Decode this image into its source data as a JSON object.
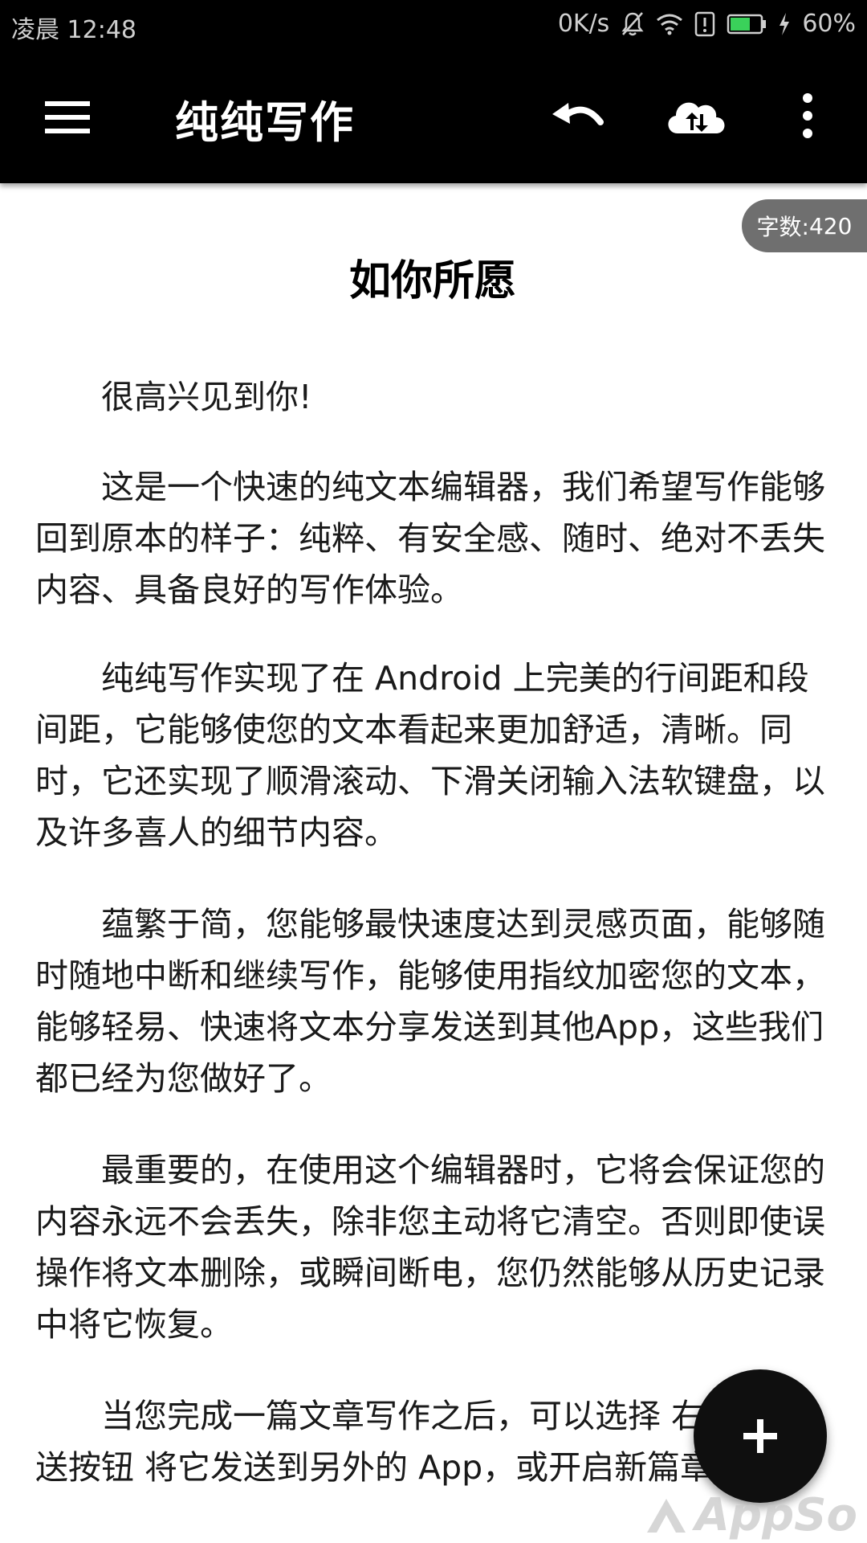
{
  "status_bar": {
    "time": "凌晨 12:48",
    "network_speed": "0K/s",
    "battery": "60%",
    "icons": [
      "bell-off-icon",
      "wifi-icon",
      "alert-icon",
      "battery-icon",
      "charging-icon"
    ]
  },
  "app_bar": {
    "title": "纯纯写作",
    "icons": [
      "menu-icon",
      "undo-icon",
      "cloud-sync-icon",
      "more-vertical-icon"
    ]
  },
  "word_count": {
    "label": "字数: ",
    "value": "420"
  },
  "document": {
    "title": "如你所愿",
    "paragraphs": [
      "很高兴见到你!",
      "这是一个快速的纯文本编辑器，我们希望写作能够回到原本的样子：纯粹、有安全感、随时、绝对不丢失内容、具备良好的写作体验。",
      "纯纯写作实现了在 Android 上完美的行间距和段间距，它能够使您的文本看起来更加舒适，清晰。同时，它还实现了顺滑滚动、下滑关闭输入法软键盘，以及许多喜人的细节内容。",
      "蕴繁于简，您能够最快速度达到灵感页面，能够随时随地中断和继续写作，能够使用指纹加密您的文本，能够轻易、快速将文本分享发送到其他App，这些我们都已经为您做好了。",
      "最重要的，在使用这个编辑器时，它将会保证您的内容永远不会丢失，除非您主动将它清空。否则即使误操作将文本删除，或瞬间断电，您仍然能够从历史记录中将它恢复。",
      "当您完成一篇文章写作之后，可以选择 右上角 发送按钮 将它发送到另外的 App，或开启新篇章。"
    ]
  },
  "fab": {
    "icon": "plus-icon"
  },
  "watermark": {
    "text": "AppSo"
  }
}
